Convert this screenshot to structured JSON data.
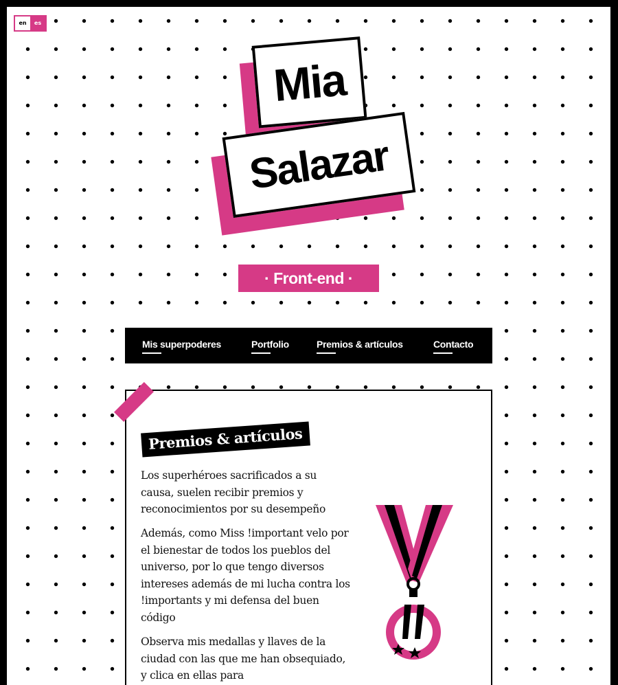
{
  "lang": {
    "option1": "en",
    "option2": "es"
  },
  "hero": {
    "first_name": "Mia",
    "last_name": "Salazar",
    "role": "· Front-end ·"
  },
  "nav": {
    "items": [
      {
        "label": "Mis superpoderes"
      },
      {
        "label": "Portfolio"
      },
      {
        "label": "Premios & artículos"
      },
      {
        "label": "Contacto"
      }
    ]
  },
  "section": {
    "title": "Premios & artículos",
    "paragraphs": [
      "Los superhéroes sacrificados a su causa, suelen recibir premios y reconocimientos por su desempeño",
      "Además, como Miss !important velo por el bienestar de todos los pueblos del universo, por lo que tengo diversos intereses además de mi lucha contra los !importants y mi defensa del buen código",
      "Observa mis medallas y llaves de la ciudad con las que me han obsequiado, y clica en ellas para"
    ],
    "medal_icon": "medal-icon"
  },
  "colors": {
    "accent": "#d63a86",
    "ink": "#000000",
    "paper": "#ffffff"
  }
}
